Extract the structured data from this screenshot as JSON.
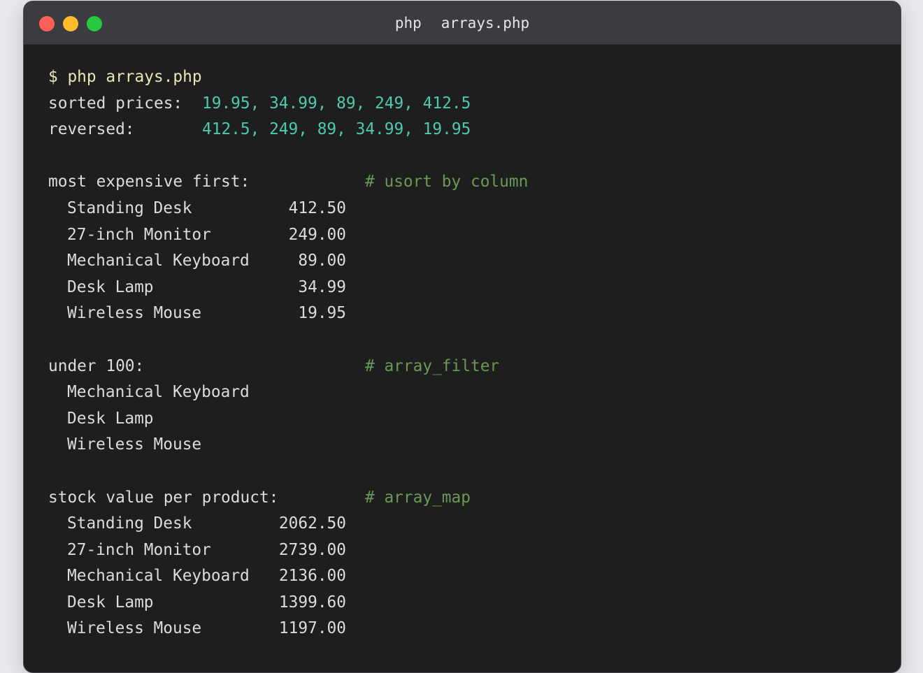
{
  "window": {
    "title_parts": [
      "php",
      "arrays.php"
    ],
    "controls": {
      "close_color": "#ff5f56",
      "minimize_color": "#ffbd2e",
      "zoom_color": "#27c93f"
    }
  },
  "terminal": {
    "prompt": "$ php arrays.php",
    "sorted": {
      "label": "sorted prices:",
      "values": "19.95, 34.99, 89, 249, 412.5"
    },
    "reversed": {
      "label": "reversed:",
      "values": "412.5, 249, 89, 34.99, 19.95"
    },
    "expensive": {
      "heading": "most expensive first:",
      "comment": "# usort by column",
      "rows": [
        {
          "name": "Standing Desk",
          "value": "412.50"
        },
        {
          "name": "27-inch Monitor",
          "value": "249.00"
        },
        {
          "name": "Mechanical Keyboard",
          "value": "89.00"
        },
        {
          "name": "Desk Lamp",
          "value": "34.99"
        },
        {
          "name": "Wireless Mouse",
          "value": "19.95"
        }
      ]
    },
    "under": {
      "heading": "under 100:",
      "comment": "# array_filter",
      "rows": [
        "Mechanical Keyboard",
        "Desk Lamp",
        "Wireless Mouse"
      ]
    },
    "stock": {
      "heading": "stock value per product:",
      "comment": "# array_map",
      "rows": [
        {
          "name": "Standing Desk",
          "value": "2062.50"
        },
        {
          "name": "27-inch Monitor",
          "value": "2739.00"
        },
        {
          "name": "Mechanical Keyboard",
          "value": "2136.00"
        },
        {
          "name": "Desk Lamp",
          "value": "1399.60"
        },
        {
          "name": "Wireless Mouse",
          "value": "1197.00"
        }
      ]
    }
  }
}
